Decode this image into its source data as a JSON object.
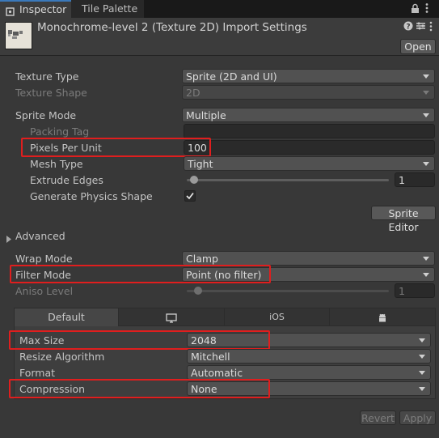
{
  "tabs": {
    "inspector": "Inspector",
    "tile_palette": "Tile Palette"
  },
  "header": {
    "title": "Monochrome-level 2 (Texture 2D) Import Settings",
    "open_label": "Open"
  },
  "fields": {
    "texture_type": {
      "label": "Texture Type",
      "value": "Sprite (2D and UI)"
    },
    "texture_shape": {
      "label": "Texture Shape",
      "value": "2D"
    },
    "sprite_mode": {
      "label": "Sprite Mode",
      "value": "Multiple"
    },
    "packing_tag": {
      "label": "Packing Tag",
      "value": ""
    },
    "pixels_per_unit": {
      "label": "Pixels Per Unit",
      "value": "100"
    },
    "mesh_type": {
      "label": "Mesh Type",
      "value": "Tight"
    },
    "extrude_edges": {
      "label": "Extrude Edges",
      "value": "1",
      "level": 0.0
    },
    "generate_physics_shape": {
      "label": "Generate Physics Shape",
      "checked": true
    },
    "sprite_editor_label": "Sprite Editor",
    "advanced_label": "Advanced",
    "wrap_mode": {
      "label": "Wrap Mode",
      "value": "Clamp"
    },
    "filter_mode": {
      "label": "Filter Mode",
      "value": "Point (no filter)"
    },
    "aniso_level": {
      "label": "Aniso Level",
      "value": "1",
      "level": 0.0
    }
  },
  "platform": {
    "tabs": {
      "default": "Default",
      "ios": "iOS"
    },
    "max_size": {
      "label": "Max Size",
      "value": "2048"
    },
    "resize_algorithm": {
      "label": "Resize Algorithm",
      "value": "Mitchell"
    },
    "format": {
      "label": "Format",
      "value": "Automatic"
    },
    "compression": {
      "label": "Compression",
      "value": "None"
    }
  },
  "footer": {
    "revert_label": "Revert",
    "apply_label": "Apply"
  },
  "icons": [
    "lock-icon",
    "menu-icon",
    "help-icon",
    "preset-icon",
    "more-icon",
    "monitor-icon",
    "android-icon",
    "checkmark-icon",
    "foldout-arrow-icon"
  ],
  "colors": {
    "highlight": "#e01e1e",
    "tab_accent": "#3a79bb"
  }
}
